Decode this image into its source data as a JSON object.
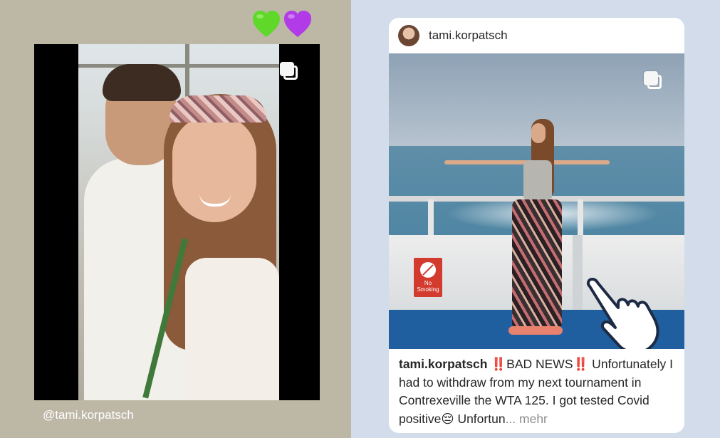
{
  "story": {
    "emoji": [
      "green-heart",
      "purple-heart"
    ],
    "mention": "@tami.korpatsch",
    "icon": "multi-photo-icon"
  },
  "post": {
    "username": "tami.korpatsch",
    "photo_icon": "multi-photo-icon",
    "tap_hint_icon": "pointing-hand-icon",
    "sign_text": "No Smoking",
    "caption": {
      "user": "tami.korpatsch",
      "bang_left": "‼️",
      "headline": "BAD NEWS",
      "bang_right": "‼️",
      "body": " Unfortunately I had to withdraw from my next tournament in Contrexeville the WTA 125. I got tested Covid positive😔 Unfortun",
      "ellipsis": "...",
      "more": " mehr"
    }
  },
  "colors": {
    "left_background": "#bdb7a6",
    "right_background": "#d3dceb",
    "card": "#ffffff",
    "alert_red": "#d32f2f",
    "heart_green": "#5fd82a",
    "heart_purple": "#b13be6"
  }
}
